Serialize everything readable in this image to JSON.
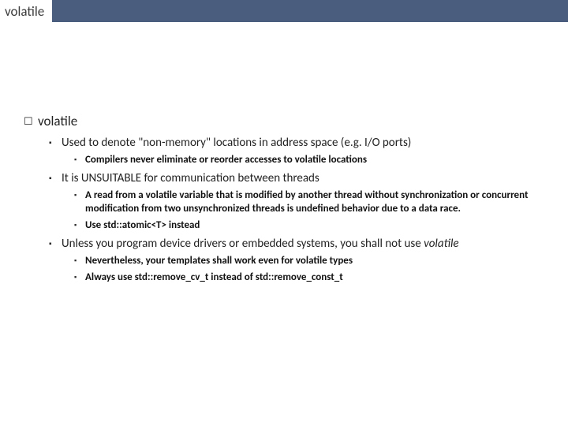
{
  "title": "volatile",
  "lvl1": {
    "text": "volatile"
  },
  "sec1": {
    "heading": "Used to denote \"non-memory\" locations in address space (e.g. I/O ports)",
    "items": [
      "Compilers never eliminate or reorder accesses to volatile locations"
    ]
  },
  "sec2": {
    "heading": "It is UNSUITABLE for communication between threads",
    "items": [
      "A read from a volatile variable that is modified by another thread without synchronization or concurrent modification from two unsynchronized threads is undefined behavior due to a data race.",
      "Use std::atomic<T> instead"
    ]
  },
  "sec3": {
    "heading_pre": "Unless you program device drivers or embedded systems, you shall not use ",
    "heading_ital": "volatile",
    "items": [
      "Nevertheless, your templates shall work even for volatile types",
      "Always use std::remove_cv_t instead of std::remove_const_t"
    ]
  }
}
